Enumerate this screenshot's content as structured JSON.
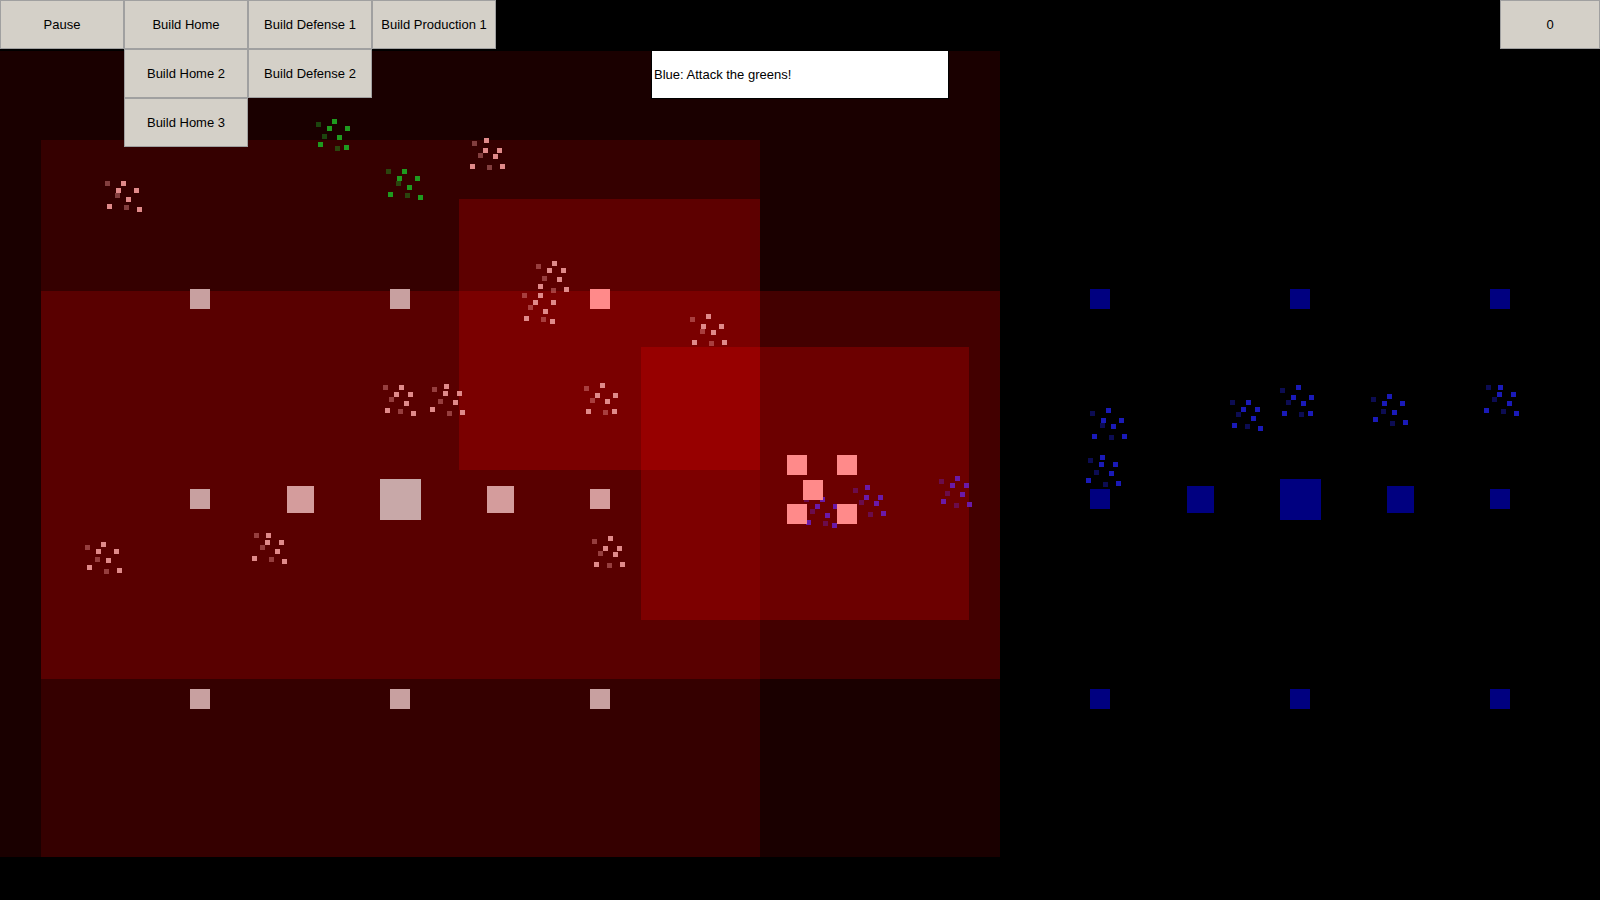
{
  "button_columns": [
    [
      "Pause"
    ],
    [
      "Build Home",
      "Build Home 2",
      "Build Home 3"
    ],
    [
      "Build Defense 1",
      "Build Defense 2"
    ],
    [
      "Build Production 1"
    ]
  ],
  "score": "0",
  "chat": {
    "value": "Blue: Attack the greens!"
  },
  "territory": [
    {
      "team": "red",
      "level": 0.1
    },
    {
      "team": "red",
      "level": 0.12
    },
    {
      "team": "red",
      "level": 0.18
    },
    {
      "team": "red",
      "level": 0.2
    },
    {
      "team": "red",
      "level": 0.22
    }
  ],
  "buildings": [
    {
      "team": "red",
      "color": "#c8a0a0"
    },
    {
      "team": "red",
      "color": "#c8a0a0"
    },
    {
      "team": "red",
      "color": "#ff8a8a"
    },
    {
      "team": "red",
      "color": "#c8a0a0"
    },
    {
      "team": "red",
      "color": "#d49c9c"
    },
    {
      "team": "red",
      "color": "#c8a8a8"
    },
    {
      "team": "red",
      "color": "#d49c9c"
    },
    {
      "team": "red",
      "color": "#d49c9c"
    },
    {
      "team": "red",
      "color": "#c8a0a0"
    },
    {
      "team": "red",
      "color": "#c8a0a0"
    },
    {
      "team": "red",
      "color": "#c8a0a0"
    },
    {
      "team": "red",
      "color": "#ff8a8a"
    },
    {
      "team": "red",
      "color": "#ff8a8a"
    },
    {
      "team": "red",
      "color": "#ff8a8a"
    },
    {
      "team": "red",
      "color": "#ff8a8a"
    },
    {
      "team": "red",
      "color": "#ff8a8a"
    },
    {
      "team": "blue",
      "color": "#000080"
    },
    {
      "team": "blue",
      "color": "#000080"
    },
    {
      "team": "blue",
      "color": "#000080"
    },
    {
      "team": "blue",
      "color": "#000080"
    },
    {
      "team": "blue",
      "color": "#000080"
    },
    {
      "team": "blue",
      "color": "#000080"
    },
    {
      "team": "blue",
      "color": "#000080"
    },
    {
      "team": "blue",
      "color": "#000080"
    },
    {
      "team": "blue",
      "color": "#000080"
    },
    {
      "team": "blue",
      "color": "#000080"
    },
    {
      "team": "blue",
      "color": "#000080"
    }
  ],
  "unit_groups": [
    {
      "team": "red",
      "color": "#e08a8a"
    },
    {
      "team": "red",
      "color": "#e08a8a"
    },
    {
      "team": "red",
      "color": "#e08a8a"
    },
    {
      "team": "red",
      "color": "#e08a8a"
    },
    {
      "team": "red",
      "color": "#e08a8a"
    },
    {
      "team": "red",
      "color": "#e08a8a"
    },
    {
      "team": "red",
      "color": "#e08a8a"
    },
    {
      "team": "red",
      "color": "#e08a8a"
    },
    {
      "team": "red",
      "color": "#e08a8a"
    },
    {
      "team": "red",
      "color": "#e08a8a"
    },
    {
      "team": "red",
      "color": "#e08a8a"
    },
    {
      "team": "green",
      "color": "#1f9a1f"
    },
    {
      "team": "green",
      "color": "#1f9a1f"
    },
    {
      "team": "purple",
      "color": "#6a1aa8"
    },
    {
      "team": "purple",
      "color": "#6a1aa8"
    },
    {
      "team": "purple",
      "color": "#6a1aa8"
    },
    {
      "team": "blue",
      "color": "#1a1ab8"
    },
    {
      "team": "blue",
      "color": "#1a1ab8"
    },
    {
      "team": "blue",
      "color": "#1a1ab8"
    },
    {
      "team": "blue",
      "color": "#1a1ab8"
    },
    {
      "team": "blue",
      "color": "#1a1ab8"
    },
    {
      "team": "blue",
      "color": "#1a1ab8"
    }
  ]
}
